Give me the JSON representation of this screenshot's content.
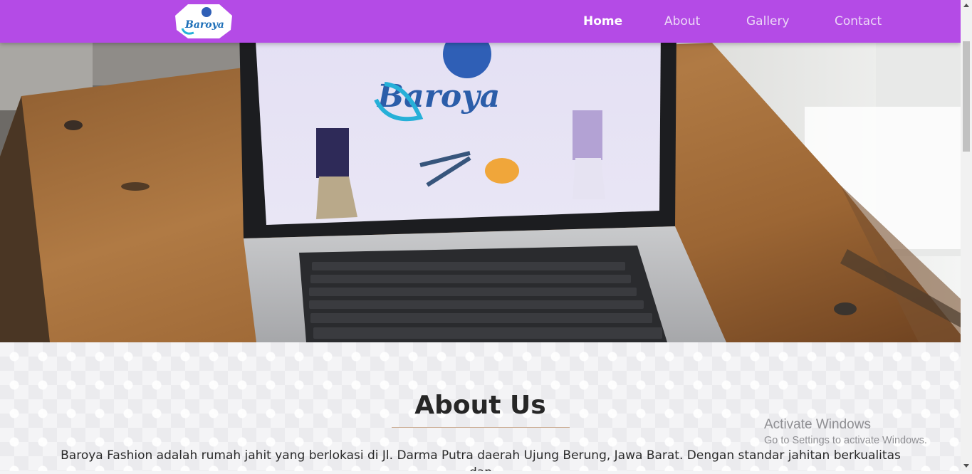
{
  "navbar": {
    "logo_text": "Baroya",
    "items": [
      {
        "label": "Home",
        "active": true
      },
      {
        "label": "About",
        "active": false
      },
      {
        "label": "Gallery",
        "active": false
      },
      {
        "label": "Contact",
        "active": false
      }
    ],
    "background_color": "#b44be6"
  },
  "hero": {
    "screen_logo_text": "Baroya"
  },
  "about": {
    "title": "About Us",
    "text": "Baroya Fashion adalah rumah jahit yang berlokasi di Jl. Darma Putra daerah Ujung Berung, Jawa Barat. Dengan standar jahitan berkualitas dan"
  },
  "watermark": {
    "title": "Activate Windows",
    "subtitle": "Go to Settings to activate Windows."
  }
}
